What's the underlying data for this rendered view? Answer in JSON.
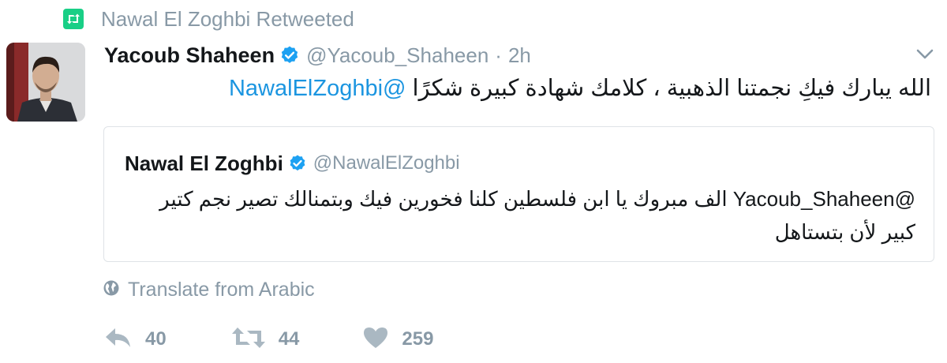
{
  "retweet_context": {
    "label": "Nawal El Zoghbi Retweeted",
    "icon": "retweet-icon",
    "badge_color": "#19cf86"
  },
  "tweet": {
    "author_name": "Yacoub Shaheen",
    "handle": "@Yacoub_Shaheen",
    "separator": "·",
    "time": "2h",
    "verified_icon": "verified-badge-icon",
    "text_before_mention": "الله يبارك فيكِ نجمتنا الذهبية ، كلامك شهادة كبيرة شكرًا ",
    "mention": "@NawalElZoghbi",
    "menu_icon": "chevron-down-icon"
  },
  "quoted_tweet": {
    "author_name": "Nawal El Zoghbi",
    "handle": "@NawalElZoghbi",
    "mention": "@Yacoub_Shaheen",
    "text": " الف مبروك يا ابن فلسطين كلنا فخورين فيك وبتمنالك تصير نجم كتير كبير لأن بتستاهل"
  },
  "translate": {
    "label": "Translate from Arabic",
    "icon": "globe-icon"
  },
  "actions": {
    "reply_count": "40",
    "retweet_count": "44",
    "like_count": "259",
    "reply_icon": "reply-icon",
    "retweet_icon": "retweet-icon",
    "like_icon": "heart-icon"
  },
  "colors": {
    "link": "#1b95e0",
    "muted": "#8899a6",
    "verified": "#1da1f2",
    "retweet_green": "#19cf86"
  }
}
